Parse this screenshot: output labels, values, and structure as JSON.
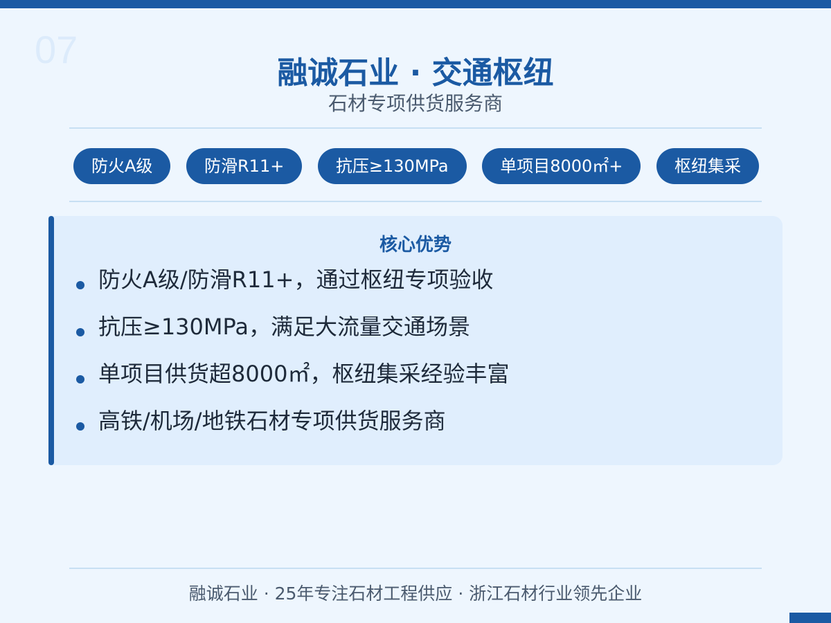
{
  "slide": {
    "page_number": "07",
    "title": "融诚石业 · 交通枢纽",
    "subtitle": "石材专项供货服务商"
  },
  "tags": [
    {
      "label": "防火A级"
    },
    {
      "label": "防滑R11+"
    },
    {
      "label": "抗压≥130MPa"
    },
    {
      "label": "单项目8000㎡+"
    },
    {
      "label": "枢纽集采"
    }
  ],
  "advantages": {
    "heading": "核心优势",
    "items": [
      {
        "text": "防火A级/防滑R11+，通过枢纽专项验收"
      },
      {
        "text": "抗压≥130MPa，满足大流量交通场景"
      },
      {
        "text": "单项目供货超8000㎡，枢纽集采经验丰富"
      },
      {
        "text": "高铁/机场/地铁石材专项供货服务商"
      }
    ]
  },
  "footer": {
    "text": "融诚石业 · 25年专注石材工程供应 · 浙江石材行业领先企业"
  },
  "colors": {
    "accent": "#1b5aa3",
    "background": "#eef6fe",
    "panel": "#e0eefd"
  }
}
